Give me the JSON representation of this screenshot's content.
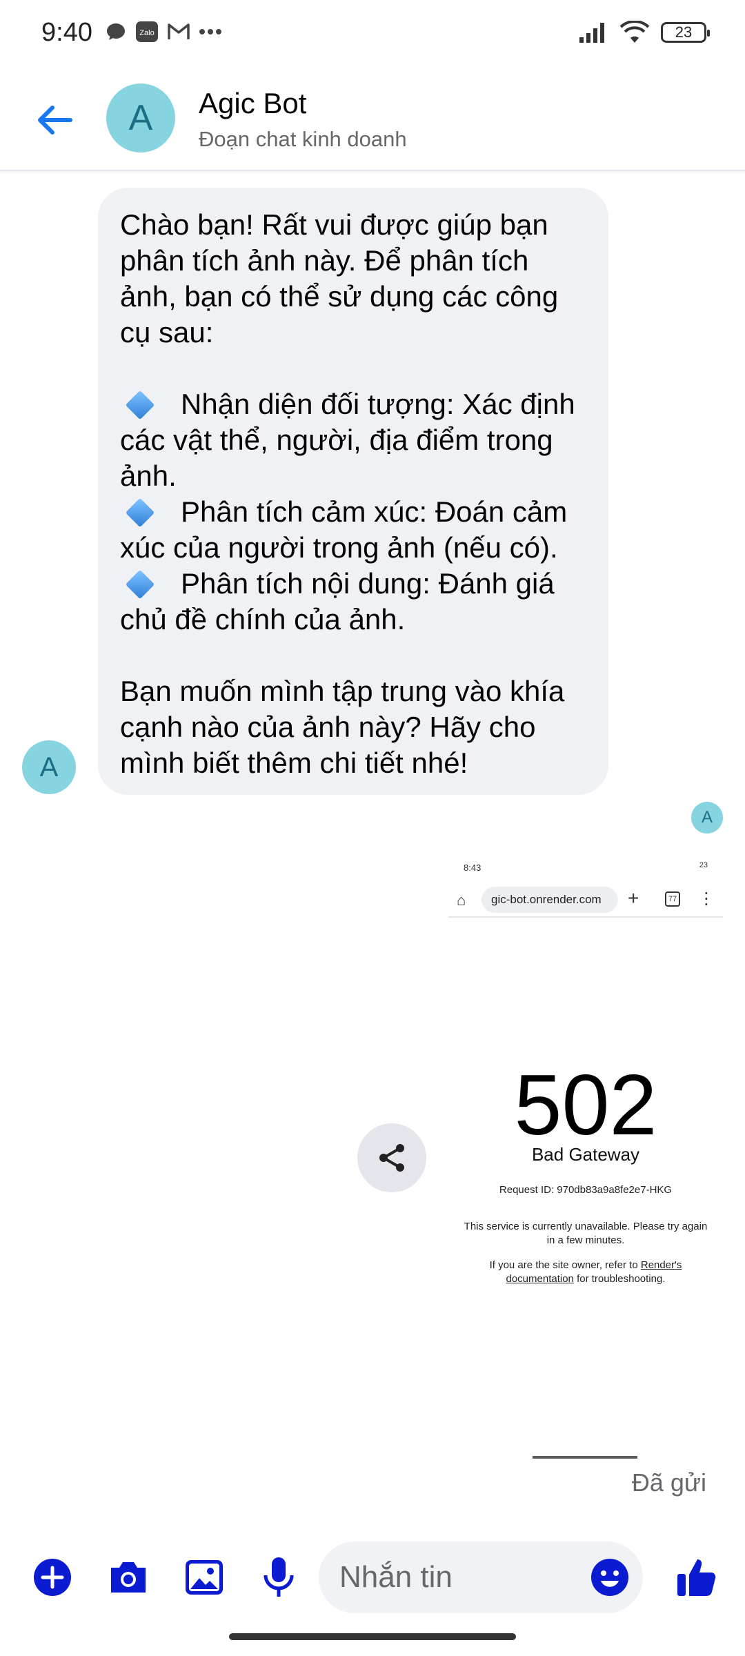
{
  "colors": {
    "accent": "#0a1bd1",
    "back_arrow": "#1877f2",
    "avatar_bg": "#86d4e0",
    "bubble_bg": "#f0f1f5"
  },
  "status_bar": {
    "time": "9:40",
    "notif_icons": [
      "chat-bubble-icon",
      "zalo-icon",
      "gmail-icon",
      "more-dots-icon"
    ],
    "battery": "23"
  },
  "header": {
    "back_icon": "arrow-left-icon",
    "avatar_letter": "A",
    "name": "Agic Bot",
    "subtitle": "Đoạn chat kinh doanh"
  },
  "conversation": {
    "bot_message": {
      "intro": "Chào bạn! Rất vui được giúp bạn phân tích ảnh này. Để phân tích ảnh, bạn có thể sử dụng các công cụ sau:",
      "bullets": [
        "Nhận diện đối tượng: Xác định các vật thể, người, địa điểm trong ảnh.",
        "Phân tích cảm xúc: Đoán cảm xúc của người trong ảnh (nếu có).",
        "Phân tích nội dung: Đánh giá chủ đề chính của ảnh."
      ],
      "outro": "Bạn muốn mình tập trung vào khía cạnh nào của ảnh này? Hãy cho mình biết thêm chi tiết nhé!",
      "avatar_letter": "A"
    },
    "read_receipt_letter": "A",
    "attachment": {
      "status_time": "8:43",
      "status_right": "23",
      "url": "gic-bot.onrender.com",
      "tabs_count": "77",
      "error_code": "502",
      "error_title": "Bad Gateway",
      "request_id": "Request ID: 970db83a9a8fe2e7-HKG",
      "message": "This service is currently unavailable. Please try again in a few minutes.",
      "owner_prefix": "If you are the site owner, refer to ",
      "owner_link": "Render's documentation",
      "owner_suffix": " for troubleshooting."
    },
    "sent_status": "Đã gửi"
  },
  "composer": {
    "placeholder": "Nhắn tin",
    "buttons": [
      "plus-icon",
      "camera-icon",
      "image-icon",
      "microphone-icon",
      "emoji-icon",
      "thumbs-up-icon"
    ]
  }
}
